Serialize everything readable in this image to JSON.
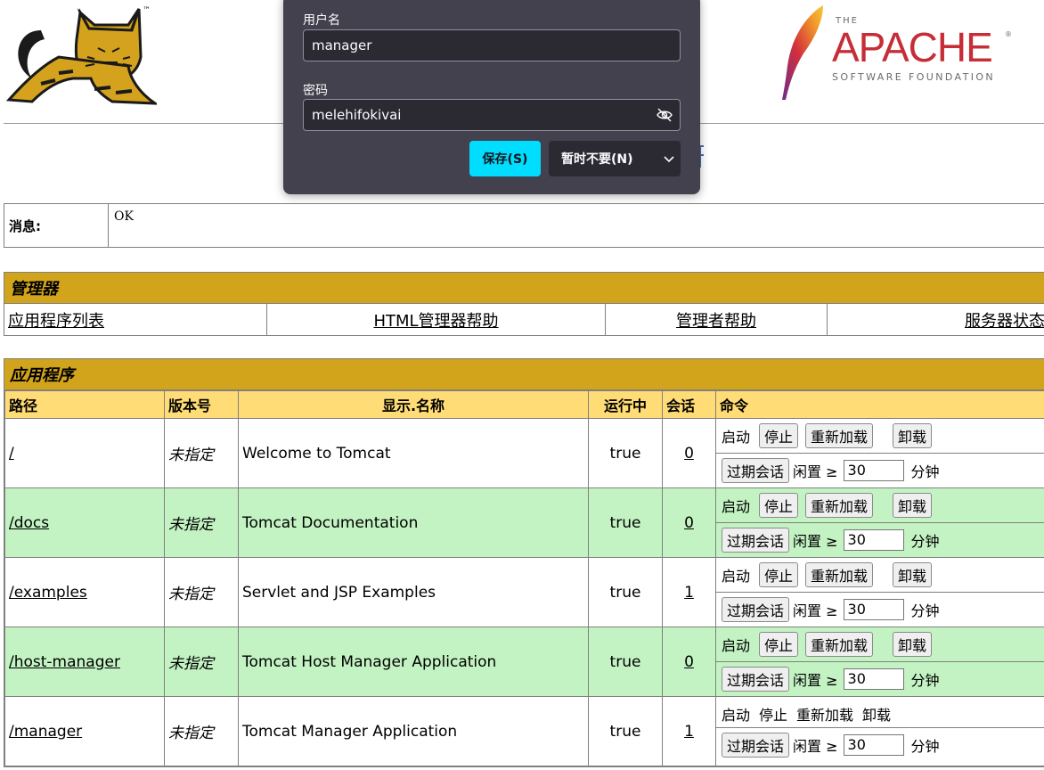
{
  "header": {
    "apache": {
      "the": "THE",
      "name": "APACHE",
      "tm": "®",
      "sub": "SOFTWARE FOUNDATION"
    },
    "tomcat_tm": "™"
  },
  "message": {
    "label": "消息:",
    "value": "OK"
  },
  "manager": {
    "title": "管理器",
    "links": [
      "应用程序列表",
      "HTML管理器帮助",
      "管理者帮助",
      "服务器状态"
    ]
  },
  "applications": {
    "title": "应用程序",
    "columns": [
      "路径",
      "版本号",
      "显示.名称",
      "运行中",
      "会话",
      "命令"
    ],
    "rows": [
      {
        "path": "/",
        "version": "未指定",
        "display_name": "Welcome to Tomcat",
        "running": "true",
        "sessions": "0"
      },
      {
        "path": "/docs",
        "version": "未指定",
        "display_name": "Tomcat Documentation",
        "running": "true",
        "sessions": "0"
      },
      {
        "path": "/examples",
        "version": "未指定",
        "display_name": "Servlet and JSP Examples",
        "running": "true",
        "sessions": "1"
      },
      {
        "path": "/host-manager",
        "version": "未指定",
        "display_name": "Tomcat Host Manager Application",
        "running": "true",
        "sessions": "0"
      },
      {
        "path": "/manager",
        "version": "未指定",
        "display_name": "Tomcat Manager Application",
        "running": "true",
        "sessions": "1"
      }
    ],
    "commands": {
      "start": "启动",
      "stop": "停止",
      "reload": "重新加载",
      "undeploy": "卸载",
      "expire": "过期会话",
      "idle_label": "闲置 ≥",
      "idle_value": "30",
      "minutes": "分钟"
    }
  },
  "popup": {
    "username_label": "用户名",
    "username_value": "manager",
    "password_label": "密码",
    "password_value": "melehifokivai",
    "save_label": "保存(S)",
    "not_now_label": "暂时不要(N)",
    "colors": {
      "background": "#42414d",
      "save": "#00ddff"
    }
  },
  "colors": {
    "section_header": "#D2A41C",
    "column_header": "#FFDC75",
    "row_alt": "#C3F3C3"
  }
}
